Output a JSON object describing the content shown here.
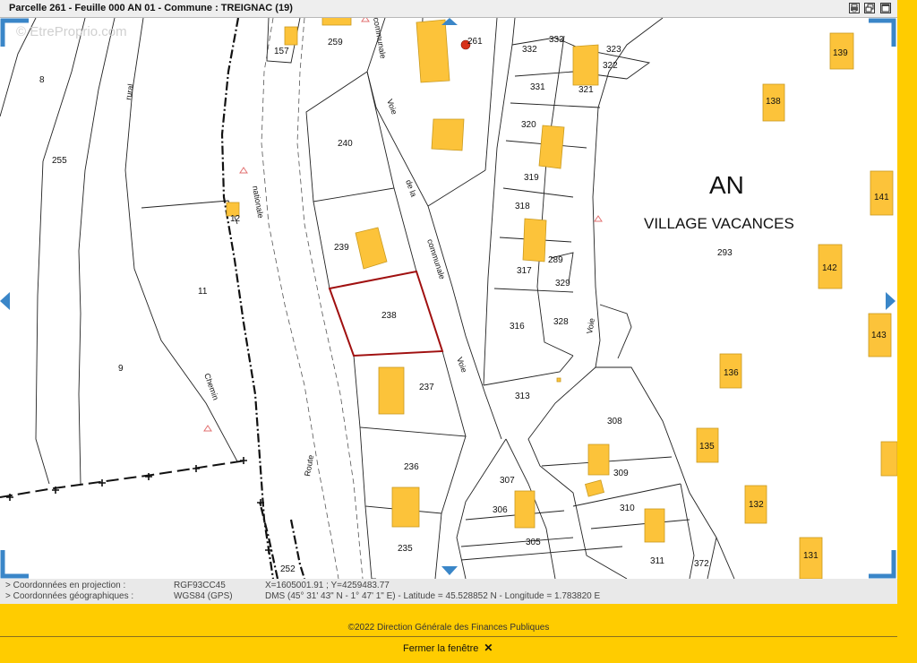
{
  "window": {
    "title": "Parcelle 261 - Feuille 000 AN 01 - Commune : TREIGNAC (19)"
  },
  "map": {
    "watermark": "© EtreProprio.com",
    "section_code": "AN",
    "section_name": "VILLAGE VACANCES",
    "selected_parcel": "238",
    "parcels": [
      "8",
      "255",
      "11",
      "9",
      "12",
      "157",
      "259",
      "261",
      "240",
      "239",
      "238",
      "237",
      "236",
      "235",
      "252",
      "332",
      "333",
      "323",
      "322",
      "331",
      "321",
      "320",
      "319",
      "318",
      "317",
      "289",
      "329",
      "316",
      "328",
      "313",
      "308",
      "309",
      "310",
      "311",
      "307",
      "306",
      "305",
      "372",
      "293",
      "139",
      "138",
      "141",
      "142",
      "143",
      "136",
      "135",
      "132",
      "131"
    ],
    "road_labels": {
      "rural": "rural",
      "nationale": "nationale",
      "chemin": "Chemin",
      "route": "Route",
      "voie_communale_top": "communale",
      "voie": "Voie",
      "de_la": "de la",
      "communale_mid": "communale",
      "voie_lower": "Voie",
      "voie_right": "Voie"
    },
    "colors": {
      "building": "#fcc33a",
      "building_stroke": "#c99a20",
      "selected_outline": "#a01010",
      "nav_arrow": "#3a86c8"
    }
  },
  "coordinates": {
    "projection_label": "> Coordonnées en projection :",
    "projection_system": "RGF93CC45",
    "projection_value": "X=1605001.91 ; Y=4259483.77",
    "geographic_label": "> Coordonnées géographiques :",
    "geographic_system": "WGS84 (GPS)",
    "geographic_value": "DMS (45° 31' 43\" N - 1° 47' 1\" E) - Latitude = 45.528852 N - Longitude = 1.783820 E"
  },
  "footer": {
    "copyright": "©2022 Direction Générale des Finances Publiques",
    "close_label": "Fermer la fenêtre",
    "close_icon": "✕"
  }
}
